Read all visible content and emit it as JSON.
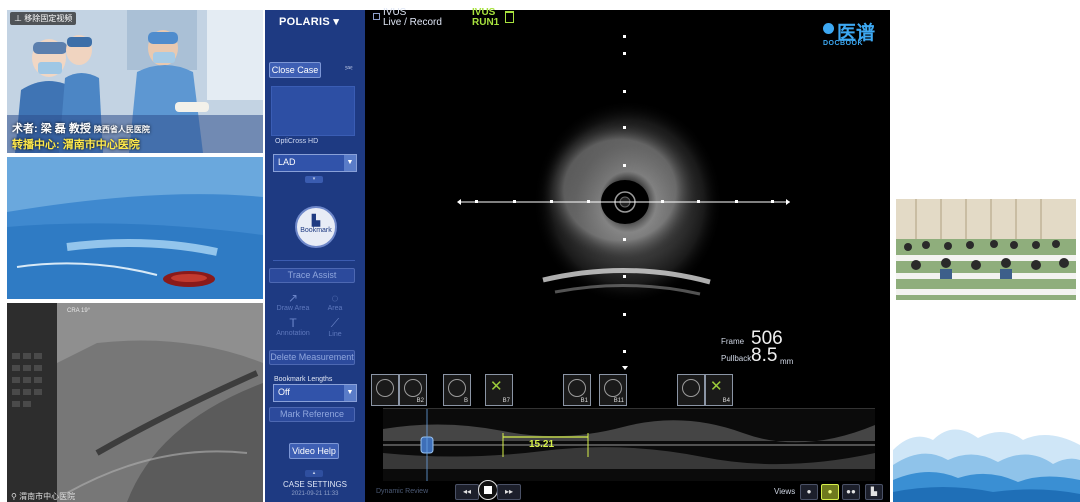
{
  "feeds": {
    "surgeon": {
      "tag": "移除固定视频",
      "caption_surgeon": "术者: 梁 磊 教授",
      "caption_hospital": "陕西省人民医院",
      "caption_center": "转播中心: 渭南市中心医院"
    },
    "angio": {
      "overlay_1": "CRA",
      "overlay_2": "19°",
      "bottom_label": "渭南市中心医院"
    }
  },
  "app": {
    "title": "POLARIS",
    "mode_line1": "IVUS",
    "mode_line2": "Live / Record",
    "run_line1": "IVUS",
    "run_line2": "RUN1",
    "logo_cn": "医谱",
    "logo_en": "DOCBOOK"
  },
  "sidebar": {
    "close_case": "Close Case",
    "catheter_label": "OptiCross HD",
    "vessel_value": "LAD",
    "bookmark_label": "Bookmark",
    "trace_assist": "Trace Assist",
    "draw_area": "Draw Area",
    "area": "Area",
    "annotation": "Annotation",
    "line": "Line",
    "delete_measurement": "Delete Measurement",
    "bookmark_lengths_label": "Bookmark Lengths",
    "bookmark_lengths_value": "Off",
    "mark_reference": "Mark Reference",
    "video_help": "Video Help",
    "case_settings": "CASE SETTINGS",
    "case_date": "2021-09-21 11:33"
  },
  "metrics": {
    "frame_label": "Frame",
    "frame_value": "506",
    "pullback_label": "Pullback",
    "pullback_value": "8.5",
    "pullback_unit": "mm"
  },
  "thumbnails": [
    "B2",
    "B",
    "B7",
    "B1",
    "B11",
    "B4"
  ],
  "longview": {
    "measurement": "15.21",
    "footer_label": "Dynamic Review",
    "views_label": "Views"
  },
  "colors": {
    "sidebar_bg": "#1e3a82",
    "button_bg": "#3e5fb4",
    "accent_green": "#a8e23e",
    "measure_yellow": "#d7f04a",
    "logo_blue": "#3da8f2"
  }
}
